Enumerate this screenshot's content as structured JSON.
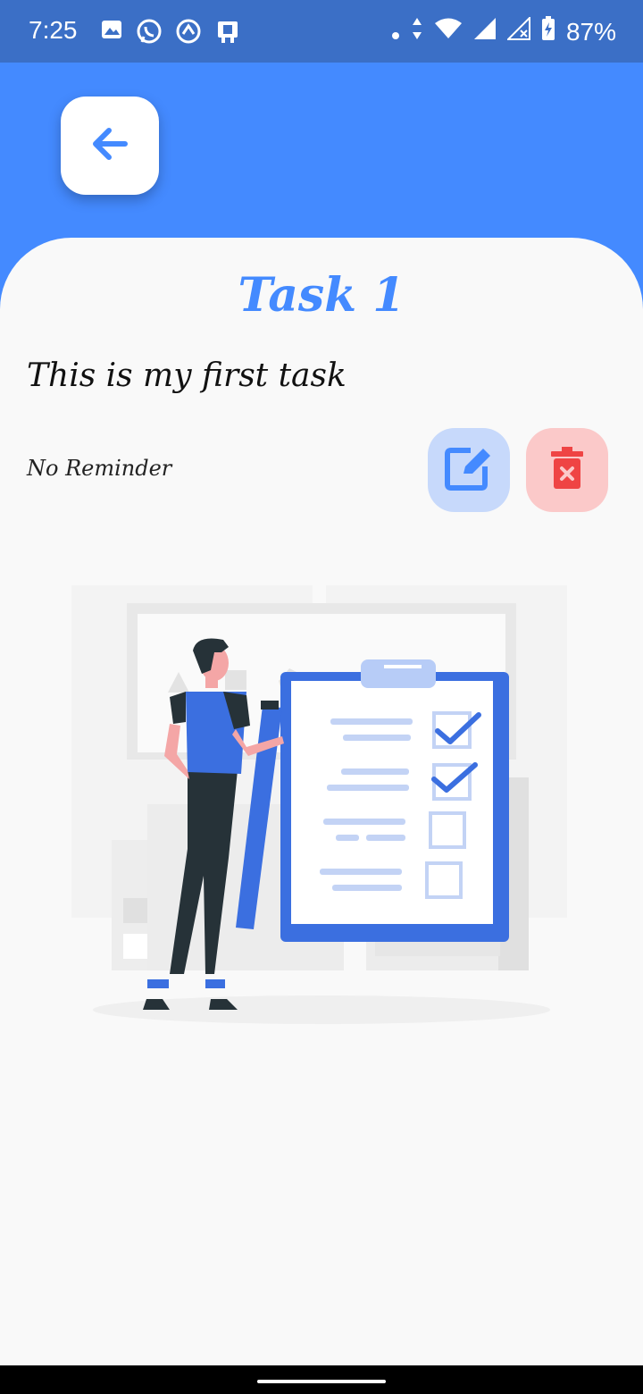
{
  "status_bar": {
    "time": "7:25",
    "battery": "87%",
    "icons_left": [
      "image-icon",
      "whatsapp-icon",
      "sync-icon",
      "sim-icon"
    ],
    "icons_right": [
      "dot-icon",
      "data-arrows-icon",
      "wifi-icon",
      "signal-icon",
      "signal-x-icon",
      "battery-charging-icon"
    ]
  },
  "header": {
    "back_icon": "arrow-left-icon"
  },
  "task": {
    "title": "Task 1",
    "description": "This is my first task",
    "reminder": "No Reminder"
  },
  "actions": {
    "edit_icon": "edit-icon",
    "delete_icon": "delete-icon"
  },
  "colors": {
    "accent": "#448aff",
    "status_bar": "#3b6fc6",
    "edit_bg": "#c7d9fb",
    "delete_bg": "#fbc9c9",
    "delete_icon": "#ef4444",
    "sheet": "#f9f9f9"
  }
}
